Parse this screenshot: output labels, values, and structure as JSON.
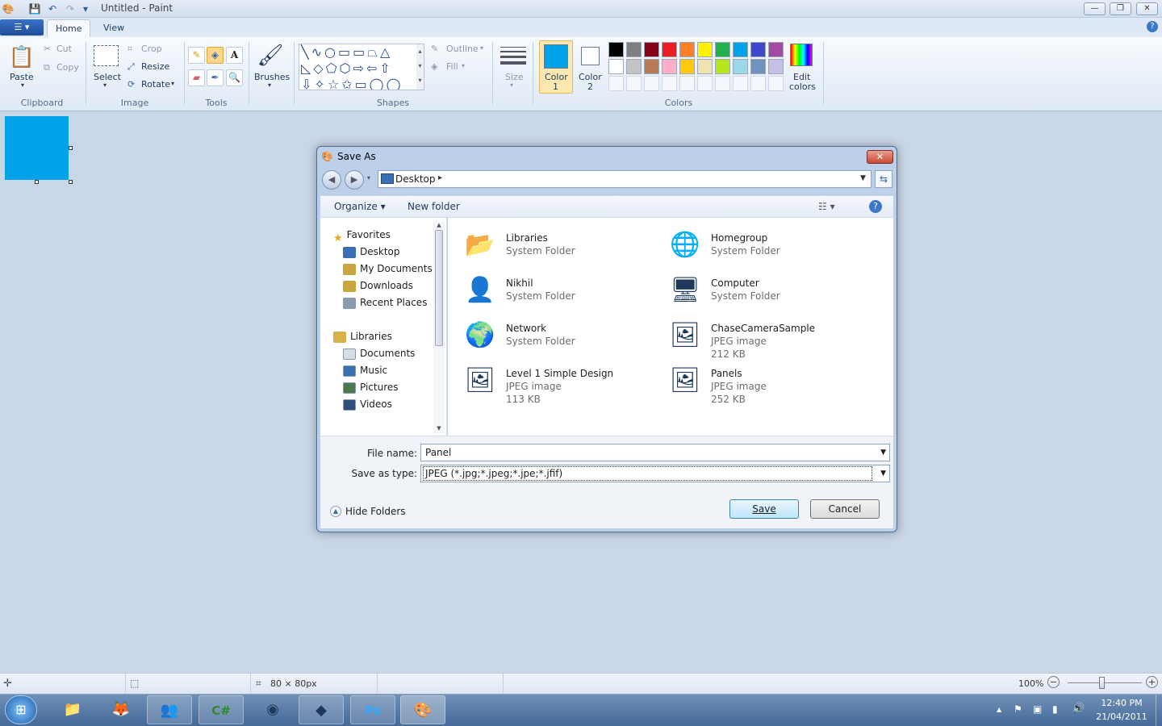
{
  "window": {
    "title": "Untitled - Paint",
    "minimize": "—",
    "restore": "❐",
    "close": "✕",
    "help": "?"
  },
  "qat": {
    "save_icon": "floppy-icon",
    "undo_icon": "undo-icon",
    "redo_icon": "redo-icon",
    "customize": "▾"
  },
  "ribbon": {
    "file_menu": "☰ ▾",
    "tabs": [
      "Home",
      "View"
    ],
    "clipboard": {
      "paste": "Paste",
      "cut": "Cut",
      "copy": "Copy",
      "group": "Clipboard"
    },
    "image": {
      "select": "Select",
      "crop": "Crop",
      "resize": "Resize",
      "rotate": "Rotate",
      "group": "Image"
    },
    "tools": {
      "group": "Tools",
      "text_tool": "A"
    },
    "brushes": {
      "label": "Brushes"
    },
    "shapes": {
      "outline": "Outline",
      "fill": "Fill",
      "group": "Shapes"
    },
    "size": {
      "label": "Size"
    },
    "colors": {
      "color1": "Color",
      "color1_num": "1",
      "color2": "Color",
      "color2_num": "2",
      "edit": "Edit",
      "edit2": "colors",
      "group": "Colors",
      "color1_value": "#00a2e8",
      "color2_value": "#ffffff",
      "palette_row1": [
        "#000000",
        "#7f7f7f",
        "#880015",
        "#ed1c24",
        "#ff7f27",
        "#fff200",
        "#22b14c",
        "#00a2e8",
        "#3f48cc",
        "#a349a4"
      ],
      "palette_row2": [
        "#ffffff",
        "#c3c3c3",
        "#b97a57",
        "#ffaec9",
        "#ffc90e",
        "#efe4b0",
        "#b5e61d",
        "#99d9ea",
        "#7092be",
        "#c8bfe7"
      ]
    }
  },
  "status": {
    "canvas_size": "80 × 80px",
    "zoom": "100%",
    "zoom_minus": "−",
    "zoom_plus": "+"
  },
  "taskbar": {
    "time": "12:40 PM",
    "date": "21/04/2011",
    "tray_up": "▲"
  },
  "dialog": {
    "title": "Save As",
    "close": "✕",
    "address": "Desktop",
    "address_arrow": "▸",
    "organize": "Organize ▾",
    "new_folder": "New folder",
    "view_toggle": "☷ ▾",
    "help": "?",
    "nav": {
      "favorites": "Favorites",
      "fav_items": [
        "Desktop",
        "My Documents",
        "Downloads",
        "Recent Places"
      ],
      "libraries": "Libraries",
      "lib_items": [
        "Documents",
        "Music",
        "Pictures",
        "Videos"
      ]
    },
    "files": [
      {
        "name": "Libraries",
        "sub1": "System Folder",
        "sub2": ""
      },
      {
        "name": "Homegroup",
        "sub1": "System Folder",
        "sub2": ""
      },
      {
        "name": "Nikhil",
        "sub1": "System Folder",
        "sub2": ""
      },
      {
        "name": "Computer",
        "sub1": "System Folder",
        "sub2": ""
      },
      {
        "name": "Network",
        "sub1": "System Folder",
        "sub2": ""
      },
      {
        "name": "ChaseCameraSample",
        "sub1": "JPEG image",
        "sub2": "212 KB"
      },
      {
        "name": "Level 1 Simple Design",
        "sub1": "JPEG image",
        "sub2": "113 KB"
      },
      {
        "name": "Panels",
        "sub1": "JPEG image",
        "sub2": "252 KB"
      }
    ],
    "file_name_label": "File name:",
    "file_name_value": "Panel",
    "save_type_label": "Save as type:",
    "save_type_value": "JPEG (*.jpg;*.jpeg;*.jpe;*.jfif)",
    "hide_folders": "Hide Folders",
    "save": "Save",
    "cancel": "Cancel"
  }
}
